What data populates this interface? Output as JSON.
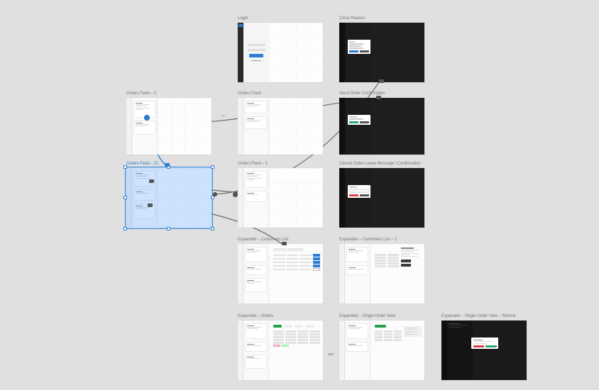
{
  "artboards": {
    "login": {
      "label": "Login"
    },
    "close_reason": {
      "label": "Close Reason"
    },
    "orders_feed_2": {
      "label": "Orders Feed – 2"
    },
    "orders_feed": {
      "label": "Orders Feed"
    },
    "send_order_confirmation": {
      "label": "Send Order Confirmation"
    },
    "orders_feed_21": {
      "label": "Orders Feed – 21"
    },
    "orders_feed_1": {
      "label": "Orders Feed – 1"
    },
    "cancel_order": {
      "label": "Cancel Order Leave Message / Confirmation"
    },
    "expanded_customers_list": {
      "label": "Expanded – Customers List"
    },
    "expanded_customers_list_1": {
      "label": "Expanded – Customers List – 1"
    },
    "expanded_orders": {
      "label": "Expanded – Orders"
    },
    "expanded_single_order_view": {
      "label": "Expanded – Single Order View"
    },
    "expanded_single_order_refund": {
      "label": "Expanded – Single Order View – Refund"
    }
  },
  "colors": {
    "selection": "#3b8fe6",
    "accent_blue": "#2d7dd2",
    "accent_green": "#2fa874",
    "accent_red": "#d64545"
  }
}
